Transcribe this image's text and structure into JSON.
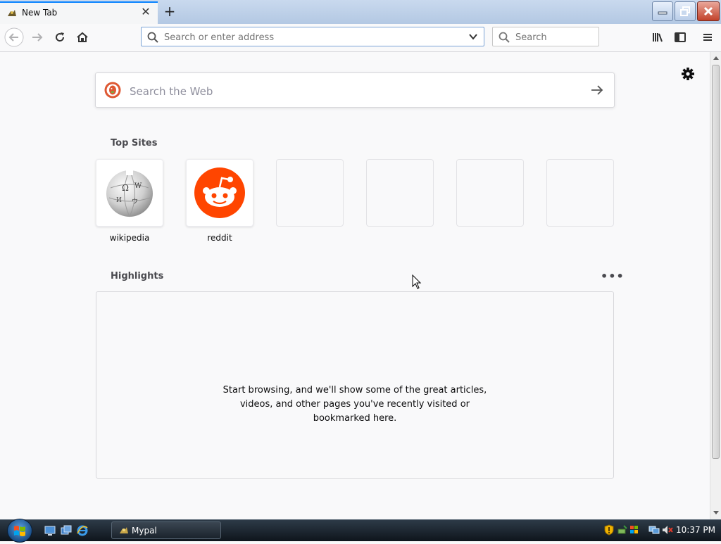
{
  "tab": {
    "title": "New Tab",
    "close_glyph": "✕",
    "new_tab_glyph": "+"
  },
  "window_controls": {
    "minimize": "minimize-icon",
    "restore": "restore-icon",
    "close": "close-icon"
  },
  "navigation": {
    "back": "back-arrow-icon",
    "forward": "forward-arrow-icon",
    "reload": "reload-icon",
    "home": "home-icon"
  },
  "urlbar": {
    "placeholder": "Search or enter address",
    "value": ""
  },
  "searchbar": {
    "placeholder": "Search"
  },
  "toolbar_icons": [
    "library-icon",
    "sidebar-icon",
    "menu-icon"
  ],
  "newtab_page": {
    "web_search": {
      "placeholder": "Search the Web"
    },
    "top_sites": {
      "title": "Top Sites",
      "sites": [
        {
          "label": "wikipedia",
          "icon": "wikipedia-globe-icon"
        },
        {
          "label": "reddit",
          "icon": "reddit-alien-icon"
        },
        {
          "label": "",
          "icon": ""
        },
        {
          "label": "",
          "icon": ""
        },
        {
          "label": "",
          "icon": ""
        },
        {
          "label": "",
          "icon": ""
        }
      ]
    },
    "highlights": {
      "title": "Highlights",
      "more_glyph": "•••",
      "empty_message": "Start browsing, and we'll show some of the great articles,\nvideos, and other pages you've recently visited or\nbookmarked here."
    }
  },
  "taskbar": {
    "task_label": "Mypal",
    "clock": "10:37 PM"
  },
  "colors": {
    "accent": "#0a84ff",
    "reddit": "#ff4500",
    "ddg": "#de5833",
    "page_bg": "#f9f9fa"
  }
}
